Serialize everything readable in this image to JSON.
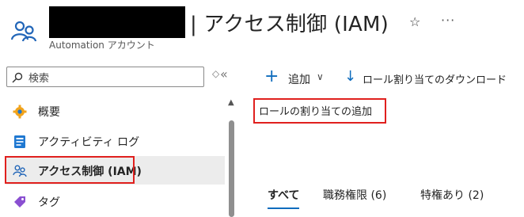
{
  "header": {
    "title": "| アクセス制御 (IAM)",
    "subtitle": "Automation アカウント",
    "star_glyph": "☆",
    "more_glyph": "···"
  },
  "search": {
    "placeholder": "検索",
    "sort_glyph": "◇",
    "collapse_glyph": "«"
  },
  "sidebar": {
    "items": [
      {
        "label": "概要",
        "icon": "gear-icon"
      },
      {
        "label": "アクティビティ ログ",
        "icon": "activity-log-icon"
      },
      {
        "label": "アクセス制御 (IAM)",
        "icon": "people-icon",
        "active": true
      },
      {
        "label": "タグ",
        "icon": "tag-icon"
      }
    ]
  },
  "toolbar": {
    "add_icon": "+",
    "add_label": "追加",
    "add_chevron": "∨",
    "download_icon": "↓",
    "download_label": "ロール割り当てのダウンロード"
  },
  "menu": {
    "add_role_assignment": "ロールの割り当ての追加"
  },
  "tabs": [
    {
      "label": "すべて",
      "active": true
    },
    {
      "label": "職務権限 (6)"
    },
    {
      "label": "特権あり (2)"
    }
  ],
  "colors": {
    "accent": "#0f6cbd",
    "highlight": "#e0201e"
  }
}
